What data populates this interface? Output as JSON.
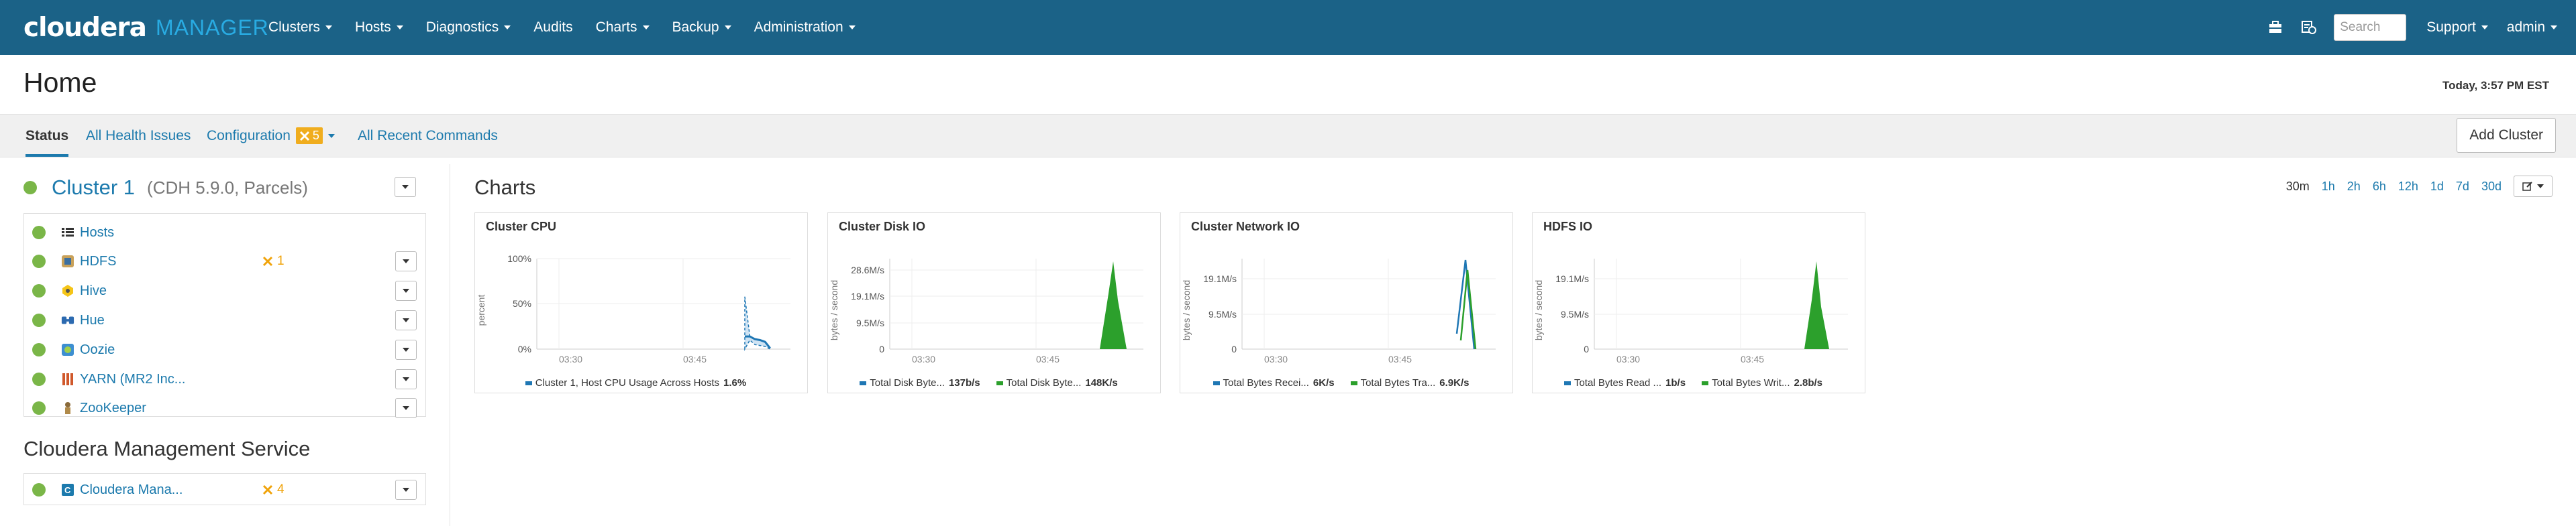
{
  "brand": {
    "name": "cloudera",
    "product": "MANAGER"
  },
  "nav": {
    "menus": [
      "Clusters",
      "Hosts",
      "Diagnostics",
      "Audits",
      "Charts",
      "Backup",
      "Administration"
    ],
    "search_placeholder": "Search",
    "support": "Support",
    "user": "admin"
  },
  "page": {
    "title": "Home",
    "timestamp": "Today, 3:57 PM EST"
  },
  "subtabs": {
    "status": "Status",
    "health": "All Health Issues",
    "configuration": "Configuration",
    "configuration_count": "5",
    "recent": "All Recent Commands",
    "add_cluster": "Add Cluster"
  },
  "cluster": {
    "name": "Cluster 1",
    "detail": "(CDH 5.9.0, Parcels)",
    "services": [
      {
        "name": "Hosts",
        "icon": "list-icon",
        "warn": ""
      },
      {
        "name": "HDFS",
        "icon": "hdfs-icon",
        "warn": "1"
      },
      {
        "name": "Hive",
        "icon": "hive-icon",
        "warn": ""
      },
      {
        "name": "Hue",
        "icon": "hue-icon",
        "warn": ""
      },
      {
        "name": "Oozie",
        "icon": "oozie-icon",
        "warn": ""
      },
      {
        "name": "YARN (MR2 Inc...",
        "icon": "yarn-icon",
        "warn": ""
      },
      {
        "name": "ZooKeeper",
        "icon": "zookeeper-icon",
        "warn": ""
      }
    ]
  },
  "cms": {
    "title": "Cloudera Management Service",
    "service": "Cloudera Mana...",
    "warn": "4"
  },
  "charts": {
    "title": "Charts",
    "ranges": [
      "30m",
      "1h",
      "2h",
      "6h",
      "12h",
      "1d",
      "7d",
      "30d"
    ],
    "selected_range": "30m"
  },
  "colors": {
    "nav": "#1b6287",
    "link": "#1c7aad",
    "good": "#7ab648",
    "warn": "#f0ad1e",
    "series_blue": "#1f77b4",
    "series_green": "#2ca02c"
  },
  "chart_data": [
    {
      "type": "line",
      "title": "Cluster CPU",
      "ylabel": "percent",
      "yticks": [
        "100%",
        "50%",
        "0%"
      ],
      "ylim": [
        0,
        100
      ],
      "xticks": [
        "03:30",
        "03:45"
      ],
      "series": [
        {
          "name": "Cluster 1, Host CPU Usage Across Hosts",
          "value_label": "1.6%",
          "x": [
            0.82,
            0.84,
            0.86,
            0.88,
            0.9,
            0.92
          ],
          "values": [
            58,
            14,
            11,
            10,
            8,
            1
          ],
          "band_low": [
            0,
            10,
            5,
            4,
            3,
            0
          ]
        }
      ]
    },
    {
      "type": "area",
      "title": "Cluster Disk IO",
      "ylabel": "bytes / second",
      "yticks": [
        "28.6M/s",
        "19.1M/s",
        "9.5M/s",
        "0"
      ],
      "xticks": [
        "03:30",
        "03:45"
      ],
      "series": [
        {
          "name": "Total Disk Byte...",
          "value_label": "137b/s"
        },
        {
          "name": "Total Disk Byte...",
          "value_label": "148K/s"
        }
      ]
    },
    {
      "type": "line",
      "title": "Cluster Network IO",
      "ylabel": "bytes / second",
      "yticks": [
        "19.1M/s",
        "9.5M/s",
        "0"
      ],
      "xticks": [
        "03:30",
        "03:45"
      ],
      "series": [
        {
          "name": "Total Bytes Recei...",
          "value_label": "6K/s"
        },
        {
          "name": "Total Bytes Tra...",
          "value_label": "6.9K/s"
        }
      ]
    },
    {
      "type": "area",
      "title": "HDFS IO",
      "ylabel": "bytes / second",
      "yticks": [
        "19.1M/s",
        "9.5M/s",
        "0"
      ],
      "xticks": [
        "03:30",
        "03:45"
      ],
      "series": [
        {
          "name": "Total Bytes Read ...",
          "value_label": "1b/s"
        },
        {
          "name": "Total Bytes Writ...",
          "value_label": "2.8b/s"
        }
      ]
    }
  ]
}
